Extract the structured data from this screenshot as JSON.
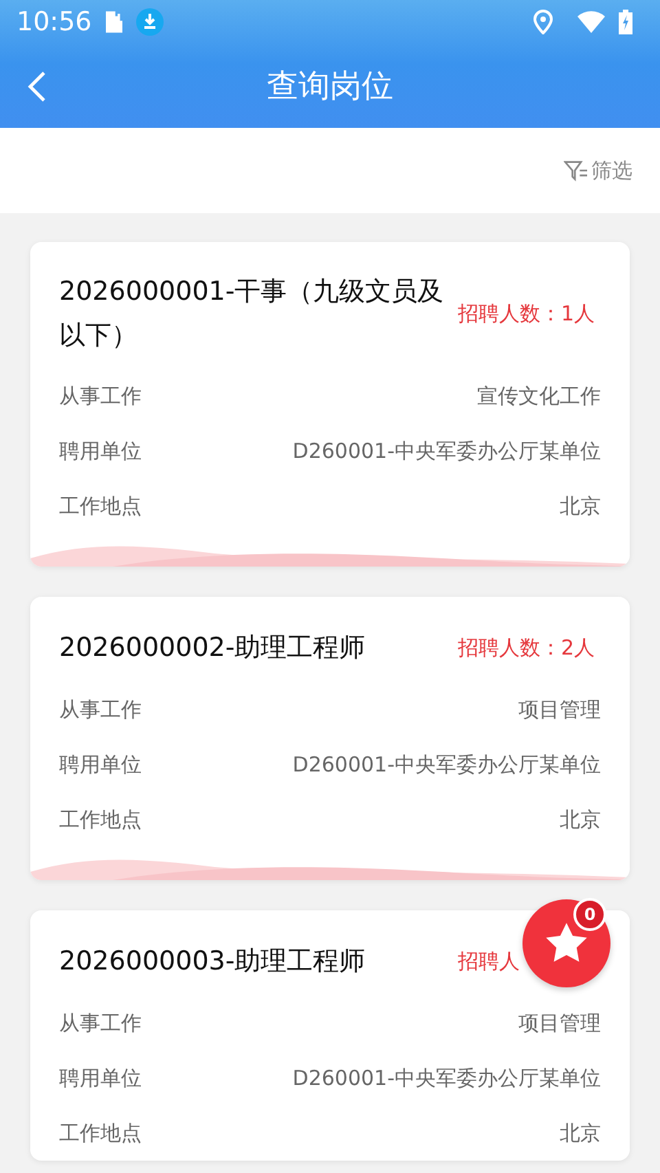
{
  "status_bar": {
    "time": "10:56"
  },
  "header": {
    "title": "查询岗位"
  },
  "filter": {
    "label": "筛选"
  },
  "jobs": [
    {
      "title": "2026000001-干事（九级文员及以下）",
      "recruit": "招聘人数：1人",
      "fields": [
        {
          "label": "从事工作",
          "value": "宣传文化工作"
        },
        {
          "label": "聘用单位",
          "value": "D260001-中央军委办公厅某单位"
        },
        {
          "label": "工作地点",
          "value": "北京"
        }
      ]
    },
    {
      "title": "2026000002-助理工程师",
      "recruit": "招聘人数：2人",
      "fields": [
        {
          "label": "从事工作",
          "value": "项目管理"
        },
        {
          "label": "聘用单位",
          "value": "D260001-中央军委办公厅某单位"
        },
        {
          "label": "工作地点",
          "value": "北京"
        }
      ]
    },
    {
      "title": "2026000003-助理工程师",
      "recruit": "招聘人",
      "fields": [
        {
          "label": "从事工作",
          "value": "项目管理"
        },
        {
          "label": "聘用单位",
          "value": "D260001-中央军委办公厅某单位"
        },
        {
          "label": "工作地点",
          "value": "北京"
        }
      ]
    }
  ],
  "favorites_button": {
    "count": "0"
  }
}
